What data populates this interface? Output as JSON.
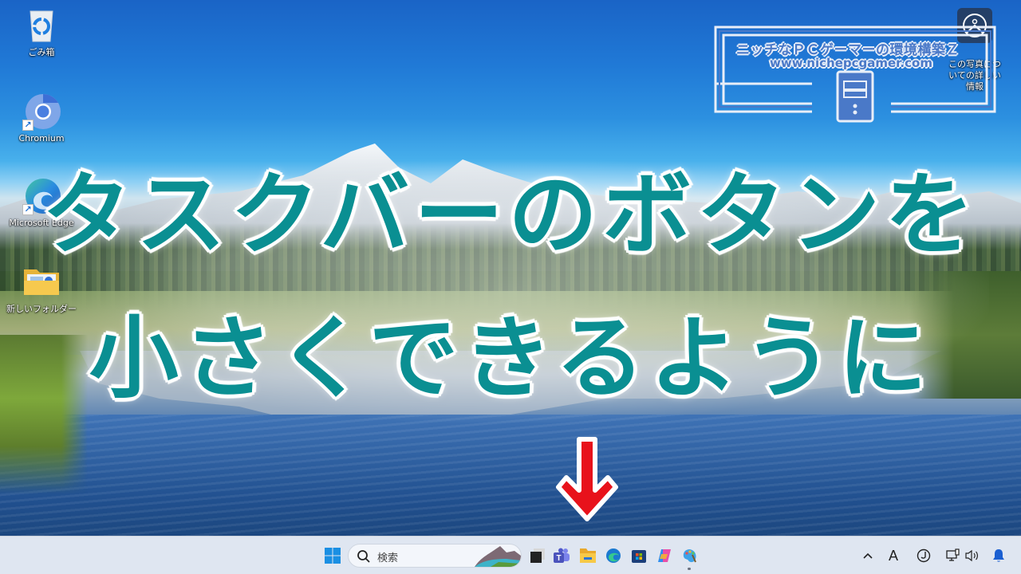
{
  "desktop": {
    "icons": [
      {
        "label": "ごみ箱",
        "icon": "recycle-bin-icon"
      },
      {
        "label": "Chromium",
        "icon": "chromium-icon",
        "shortcut": true
      },
      {
        "label": "Microsoft Edge",
        "icon": "edge-icon",
        "shortcut": true
      },
      {
        "label": "新しいフォルダー",
        "icon": "folder-icon"
      }
    ],
    "spotlight": {
      "label": "この写真についての詳しい情報",
      "icon": "camera-spotlight-icon"
    }
  },
  "overlay": {
    "headline_line1": "タスクバーのボタンを",
    "headline_line2": "小さくできるように",
    "headline_color": "#0a8f92",
    "arrow_color": "#e8121b",
    "arrow_direction": "down"
  },
  "watermark": {
    "title": "ニッチなＰＣゲーマーの環境構築Ｚ",
    "url": "www.nichepcgamer.com",
    "icon": "pc-tower-icon"
  },
  "taskbar": {
    "start_icon": "windows-start-icon",
    "search": {
      "placeholder": "検索",
      "icon": "search-icon"
    },
    "apps": [
      {
        "name": "task-view",
        "icon": "task-view-icon"
      },
      {
        "name": "teams",
        "icon": "teams-icon"
      },
      {
        "name": "file-explorer",
        "icon": "file-explorer-icon"
      },
      {
        "name": "edge",
        "icon": "edge-icon"
      },
      {
        "name": "microsoft-store",
        "icon": "store-icon"
      },
      {
        "name": "copilot",
        "icon": "copilot-icon"
      },
      {
        "name": "paint",
        "icon": "paint-icon",
        "running": true
      }
    ],
    "tray": {
      "overflow_icon": "chevron-up-icon",
      "ime_label": "A",
      "clock_icon": "clock-icon",
      "network_icon": "network-icon",
      "volume_icon": "volume-icon",
      "notification_icon": "bell-icon"
    }
  }
}
